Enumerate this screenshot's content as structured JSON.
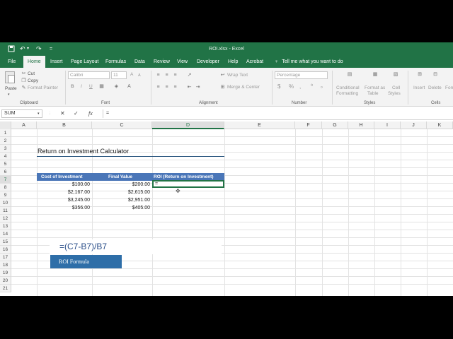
{
  "window": {
    "title": "ROI.xlsx  -  Excel"
  },
  "quick_access": {
    "save_icon": "save-icon",
    "undo_icon": "undo-icon",
    "redo_icon": "redo-icon",
    "customize": "="
  },
  "tabs": [
    {
      "label": "File"
    },
    {
      "label": "Home"
    },
    {
      "label": "Insert"
    },
    {
      "label": "Page Layout"
    },
    {
      "label": "Formulas"
    },
    {
      "label": "Data"
    },
    {
      "label": "Review"
    },
    {
      "label": "View"
    },
    {
      "label": "Developer"
    },
    {
      "label": "Help"
    },
    {
      "label": "Acrobat"
    }
  ],
  "tell_me": "Tell me what you want to do",
  "ribbon": {
    "clipboard": {
      "paste": "Paste",
      "cut": "Cut",
      "copy": "Copy",
      "format_painter": "Format Painter",
      "group": "Clipboard"
    },
    "font": {
      "name": "Calibri",
      "size": "11",
      "bold": "B",
      "italic": "I",
      "underline": "U",
      "group": "Font"
    },
    "alignment": {
      "wrap_text": "Wrap Text",
      "merge_center": "Merge & Center",
      "group": "Alignment"
    },
    "number": {
      "format": "Percentage",
      "currency": "$",
      "percent": "%",
      "comma": ",",
      "group": "Number"
    },
    "styles": {
      "conditional_1": "Conditional",
      "conditional_2": "Formatting",
      "format_as_1": "Format as",
      "format_as_2": "Table",
      "cell_styles_1": "Cell",
      "cell_styles_2": "Styles",
      "group": "Styles"
    },
    "cells": {
      "insert": "Insert",
      "delete": "Delete",
      "format": "Form",
      "group": "Cells"
    }
  },
  "formula_bar": {
    "name_box": "SUM",
    "cancel": "✕",
    "enter": "✓",
    "fx": "fx",
    "content": "="
  },
  "columns": [
    "A",
    "B",
    "C",
    "D",
    "E",
    "F",
    "G",
    "H",
    "I",
    "J",
    "K"
  ],
  "rows": [
    "1",
    "2",
    "3",
    "4",
    "5",
    "6",
    "7",
    "8",
    "9",
    "10",
    "11",
    "12",
    "13",
    "14",
    "15",
    "16",
    "17",
    "18",
    "19",
    "20",
    "21"
  ],
  "sheet": {
    "title": "Return on Investment Calculator",
    "headers": [
      "Cost of Investment",
      "Final Value",
      "ROI (Return on Investment)"
    ],
    "data": [
      [
        "$100.00",
        "$200.00"
      ],
      [
        "$2,167.00",
        "$2,615.00"
      ],
      [
        "$3,245.00",
        "$2,951.00"
      ],
      [
        "$356.00",
        "$405.00"
      ]
    ],
    "active_cell_value": "="
  },
  "overlay": {
    "formula": "=(C7-B7)/B7",
    "label": "ROI Formula"
  },
  "colors": {
    "excel_green": "#217346",
    "header_blue": "#4a76b8",
    "overlay_blue": "#2e6ea8",
    "formula_text": "#2b4f8a"
  }
}
